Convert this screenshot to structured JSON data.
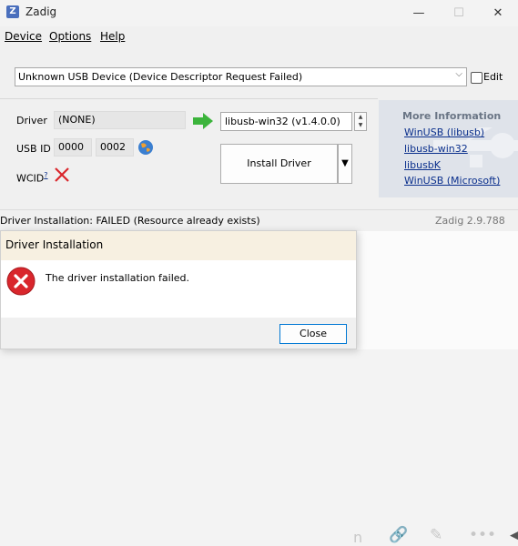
{
  "window": {
    "title": "Zadig",
    "min_glyph": "—",
    "max_glyph": "☐",
    "close_glyph": "✕"
  },
  "menu": {
    "device": "Device",
    "options": "Options",
    "help": "Help"
  },
  "device_select": {
    "value": "Unknown USB Device (Device Descriptor Request Failed)"
  },
  "edit": {
    "label": "Edit",
    "checked": false
  },
  "driver": {
    "label": "Driver",
    "current": "(NONE)",
    "target": "libusb-win32 (v1.4.0.0)"
  },
  "usb_id": {
    "label": "USB ID",
    "vid": "0000",
    "pid": "0002"
  },
  "wcid": {
    "label": "WCID",
    "superscript": "?"
  },
  "install_button": {
    "label": "Install Driver"
  },
  "more_info": {
    "title": "More Information",
    "links": [
      "WinUSB (libusb)",
      "libusb-win32",
      "libusbK",
      "WinUSB (Microsoft)"
    ]
  },
  "status": {
    "text": "Driver Installation: FAILED (Resource already exists)",
    "version": "Zadig 2.9.788"
  },
  "dialog": {
    "title": "Driver Installation",
    "message": "The driver installation failed.",
    "close_label": "Close"
  },
  "background_app": {
    "partial_text": "n"
  },
  "colors": {
    "accent": "#0078d4",
    "link": "#0a2f8c",
    "error_red": "#d9262c",
    "arrow_green": "#3cb43c"
  }
}
